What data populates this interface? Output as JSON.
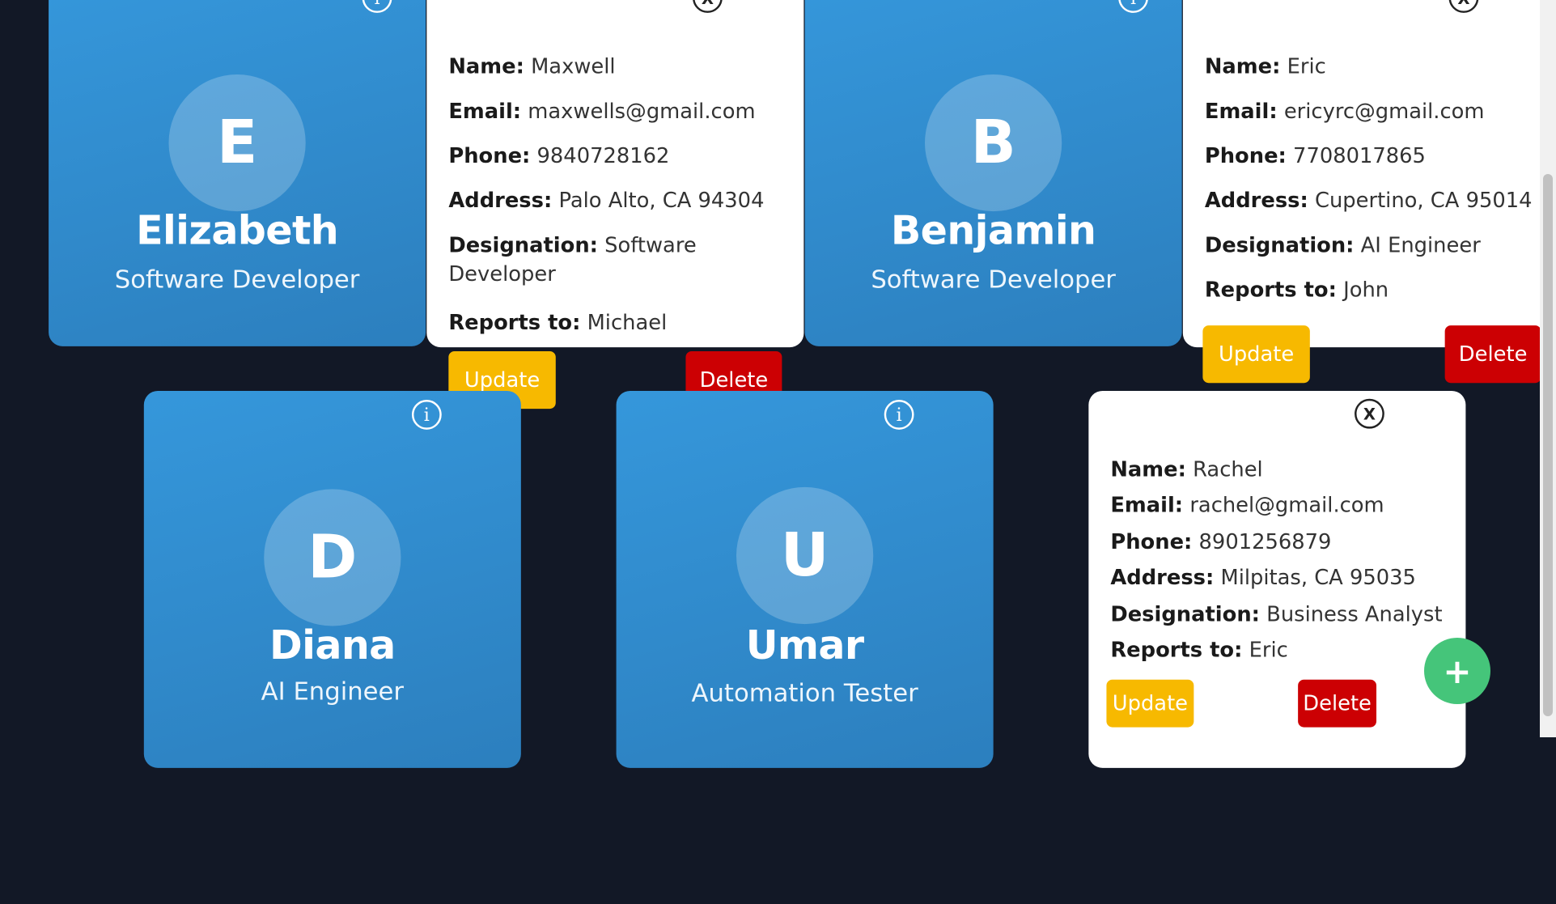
{
  "cards": {
    "elizabeth": {
      "initial": "E",
      "name": "Elizabeth",
      "role": "Software Developer"
    },
    "benjamin": {
      "initial": "B",
      "name": "Benjamin",
      "role": "Software Developer"
    },
    "diana": {
      "initial": "D",
      "name": "Diana",
      "role": "AI Engineer"
    },
    "umar": {
      "initial": "U",
      "name": "Umar",
      "role": "Automation Tester"
    }
  },
  "labels": {
    "name": "Name:",
    "email": "Email:",
    "phone": "Phone:",
    "address": "Address:",
    "designation": "Designation:",
    "reports_to": "Reports to:",
    "update": "Update",
    "delete": "Delete",
    "info_glyph": "i",
    "close_glyph": "X",
    "add_glyph": "+"
  },
  "details": {
    "maxwell": {
      "name": "Maxwell",
      "email": "maxwells@gmail.com",
      "phone": "9840728162",
      "address": "Palo Alto, CA 94304",
      "designation": "Software Developer",
      "reports_to": "Michael"
    },
    "eric": {
      "name": "Eric",
      "email": "ericyrc@gmail.com",
      "phone": "7708017865",
      "address": "Cupertino, CA 95014",
      "designation": "AI Engineer",
      "reports_to": "John"
    },
    "rachel": {
      "name": "Rachel",
      "email": "rachel@gmail.com",
      "phone": "8901256879",
      "address": "Milpitas, CA 95035",
      "designation": "Business Analyst",
      "reports_to": "Eric"
    }
  },
  "colors": {
    "background": "#121826",
    "card_blue": "#3597db",
    "update": "#f7b900",
    "delete": "#cc0003",
    "fab": "#45c57a"
  }
}
